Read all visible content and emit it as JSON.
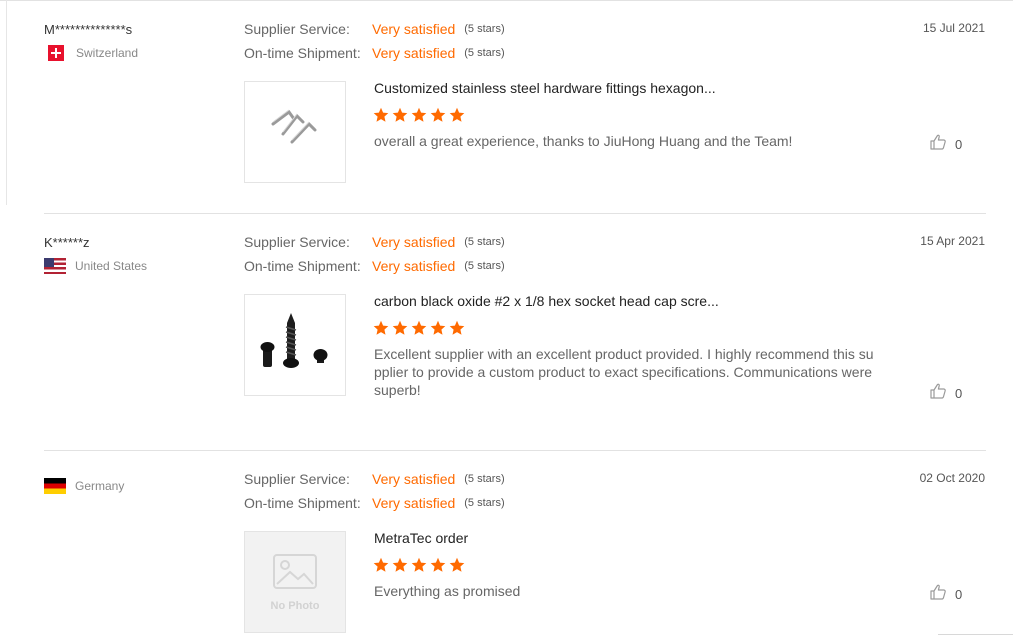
{
  "colors": {
    "accent": "#ff6a00",
    "separator": "#e2e2e2"
  },
  "rating_labels": {
    "supplier_service": "Supplier Service:",
    "ontime_shipment": "On-time Shipment:"
  },
  "reviews": [
    {
      "buyer": "M**************s",
      "country": "Switzerland",
      "flag": "switzerland-flag-icon",
      "date": "15 Jul 2021",
      "supplier_service": {
        "value": "Very satisfied",
        "stars": "(5 stars)"
      },
      "ontime_shipment": {
        "value": "Very satisfied",
        "stars": "(5 stars)"
      },
      "product_title": "Customized stainless steel hardware fittings hexagon...",
      "product_image": "l-shaped-hex-keys-photo",
      "rating": 5,
      "comment": "overall a great experience, thanks to JiuHong Huang and the Team!",
      "likes": "0"
    },
    {
      "buyer": "K******z",
      "country": "United States",
      "flag": "united-states-flag-icon",
      "date": "15 Apr 2021",
      "supplier_service": {
        "value": "Very satisfied",
        "stars": "(5 stars)"
      },
      "ontime_shipment": {
        "value": "Very satisfied",
        "stars": "(5 stars)"
      },
      "product_title": "carbon black oxide #2 x 1/8 hex socket head cap scre...",
      "product_image": "black-screws-photo",
      "rating": 5,
      "comment": "Excellent supplier with an excellent product provided.  I highly recommend this supplier to provide a custom product to exact specifications.  Communications were superb!",
      "likes": "0"
    },
    {
      "buyer": "",
      "country": "Germany",
      "flag": "germany-flag-icon",
      "date": "02 Oct 2020",
      "supplier_service": {
        "value": "Very satisfied",
        "stars": "(5 stars)"
      },
      "ontime_shipment": {
        "value": "Very satisfied",
        "stars": "(5 stars)"
      },
      "product_title": "MetraTec order",
      "product_image": "no-photo-placeholder",
      "no_photo_label": "No Photo",
      "rating": 5,
      "comment": "Everything as promised",
      "likes": "0"
    }
  ]
}
